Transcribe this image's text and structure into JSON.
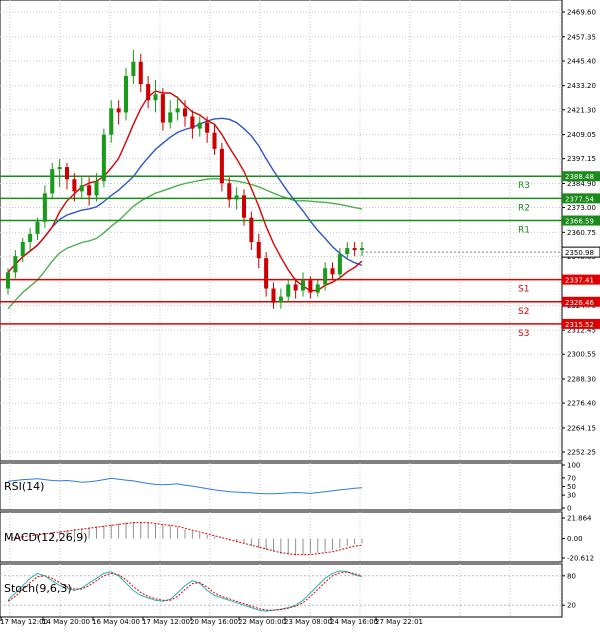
{
  "chart_data": [
    {
      "type": "candlestick",
      "name": "price",
      "ylim": [
        2252.25,
        2469.6
      ],
      "y_ticks": [
        "2469.60",
        "2457.35",
        "2445.40",
        "2433.20",
        "2421.30",
        "2409.05",
        "2397.15",
        "2384.90",
        "2373.00",
        "2360.75",
        "2348.85",
        "2324.70",
        "2312.45",
        "2300.55",
        "2288.30",
        "2276.40",
        "2264.15",
        "2252.25"
      ],
      "x_ticks": [
        "17 May 12:00",
        "14 May 20:00",
        "16 May 04:00",
        "17 May 12:00",
        "20 May 16:00",
        "22 May 00:00",
        "23 May 08:00",
        "24 May 16:00",
        "27 May 22:01"
      ],
      "colors": {
        "up": "#1a9a1a",
        "down": "#cc0000",
        "sma_fast": "#dd0000",
        "sma_mid": "#2e56c8",
        "sma_slow": "#4caf50"
      },
      "levels": [
        {
          "label": "R3",
          "value": 2388.48,
          "text": "2388.48",
          "color": "#1a8a1a"
        },
        {
          "label": "R2",
          "value": 2377.54,
          "text": "2377.54",
          "color": "#1a8a1a"
        },
        {
          "label": "R1",
          "value": 2366.59,
          "text": "2366.59",
          "color": "#1a8a1a"
        },
        {
          "label": "S1",
          "value": 2337.41,
          "text": "2337.41",
          "color": "#dd0000"
        },
        {
          "label": "S2",
          "value": 2326.46,
          "text": "2326.46",
          "color": "#dd0000"
        },
        {
          "label": "S3",
          "value": 2315.52,
          "text": "2315.52",
          "color": "#dd0000"
        }
      ],
      "last_price": {
        "value": 2350.98,
        "text": "2350.98"
      },
      "candles": [
        [
          2333,
          2341,
          2330,
          2343
        ],
        [
          2341,
          2349,
          2338,
          2352
        ],
        [
          2349,
          2356,
          2346,
          2358
        ],
        [
          2356,
          2360,
          2352,
          2363
        ],
        [
          2360,
          2366,
          2357,
          2368
        ],
        [
          2366,
          2380,
          2363,
          2384
        ],
        [
          2380,
          2392,
          2377,
          2395
        ],
        [
          2392,
          2393,
          2383,
          2397
        ],
        [
          2393,
          2387,
          2382,
          2395
        ],
        [
          2387,
          2381,
          2376,
          2390
        ],
        [
          2381,
          2384,
          2378,
          2388
        ],
        [
          2384,
          2379,
          2374,
          2388
        ],
        [
          2379,
          2386,
          2376,
          2390
        ],
        [
          2386,
          2409,
          2383,
          2412
        ],
        [
          2409,
          2422,
          2405,
          2426
        ],
        [
          2422,
          2420,
          2414,
          2426
        ],
        [
          2420,
          2438,
          2416,
          2442
        ],
        [
          2438,
          2445,
          2434,
          2451
        ],
        [
          2445,
          2434,
          2430,
          2449
        ],
        [
          2434,
          2426,
          2422,
          2438
        ],
        [
          2426,
          2429,
          2420,
          2436
        ],
        [
          2429,
          2415,
          2411,
          2432
        ],
        [
          2415,
          2420,
          2412,
          2426
        ],
        [
          2420,
          2422,
          2416,
          2428
        ],
        [
          2422,
          2418,
          2413,
          2426
        ],
        [
          2418,
          2412,
          2407,
          2421
        ],
        [
          2412,
          2415,
          2408,
          2418
        ],
        [
          2415,
          2410,
          2405,
          2418
        ],
        [
          2410,
          2402,
          2399,
          2414
        ],
        [
          2402,
          2385,
          2381,
          2405
        ],
        [
          2385,
          2377,
          2373,
          2388
        ],
        [
          2377,
          2379,
          2372,
          2383
        ],
        [
          2379,
          2368,
          2364,
          2382
        ],
        [
          2368,
          2356,
          2352,
          2371
        ],
        [
          2356,
          2348,
          2343,
          2360
        ],
        [
          2348,
          2333,
          2329,
          2351
        ],
        [
          2333,
          2326,
          2323,
          2336
        ],
        [
          2326,
          2329,
          2323,
          2333
        ],
        [
          2329,
          2335,
          2326,
          2338
        ],
        [
          2335,
          2332,
          2328,
          2338
        ],
        [
          2332,
          2337,
          2329,
          2341
        ],
        [
          2337,
          2331,
          2328,
          2339
        ],
        [
          2331,
          2335,
          2329,
          2338
        ],
        [
          2335,
          2343,
          2332,
          2346
        ],
        [
          2343,
          2340,
          2337,
          2346
        ],
        [
          2340,
          2350,
          2337,
          2353
        ],
        [
          2350,
          2353,
          2348,
          2356
        ],
        [
          2353,
          2352,
          2349,
          2356
        ],
        [
          2352,
          2353,
          2349,
          2356
        ]
      ]
    },
    {
      "type": "line",
      "name": "rsi",
      "label": "RSI(14)",
      "ylim": [
        0,
        100
      ],
      "y_ticks": [
        "100",
        "70",
        "50",
        "30",
        "0"
      ],
      "color": "#2e7de0",
      "values": [
        62,
        64,
        66,
        67,
        68,
        66,
        64,
        63,
        64,
        62,
        60,
        61,
        63,
        66,
        69,
        67,
        65,
        63,
        60,
        57,
        55,
        54,
        55,
        56,
        53,
        51,
        48,
        45,
        42,
        40,
        38,
        37,
        36,
        35,
        34,
        33,
        33,
        34,
        35,
        36,
        35,
        34,
        36,
        38,
        40,
        42,
        44,
        46,
        47
      ]
    },
    {
      "type": "histogram",
      "name": "macd",
      "label": "MACD(12,26,9)",
      "ylim": [
        -20.612,
        21.864
      ],
      "y_ticks": [
        "21.864",
        "0.00",
        "-20.612"
      ],
      "colors": {
        "bars": "#909090",
        "signal": "#dd0000"
      },
      "values": [
        1,
        2,
        3,
        4,
        5,
        6,
        7,
        8,
        9,
        10,
        11,
        12,
        13,
        14,
        15,
        16,
        17,
        18,
        18,
        17,
        16,
        15,
        14,
        12,
        10,
        8,
        6,
        4,
        2,
        0,
        -2,
        -4,
        -6,
        -8,
        -10,
        -12,
        -14,
        -16,
        -17,
        -18,
        -17,
        -16,
        -15,
        -14,
        -12,
        -10,
        -8,
        -6,
        -5
      ],
      "signal": [
        0,
        1,
        2,
        3,
        4,
        5,
        6,
        7,
        8,
        9,
        10,
        11,
        12,
        13,
        14,
        15,
        16,
        17,
        17,
        17,
        16,
        15,
        14,
        13,
        11,
        9,
        7,
        5,
        3,
        1,
        -1,
        -3,
        -5,
        -7,
        -9,
        -11,
        -13,
        -15,
        -16,
        -17,
        -17,
        -17,
        -16,
        -15,
        -14,
        -12,
        -10,
        -8,
        -7
      ]
    },
    {
      "type": "line",
      "name": "stoch",
      "label": "Stoch(9,6,3)",
      "ylim": [
        0,
        100
      ],
      "y_ticks": [
        "80",
        "20"
      ],
      "colors": {
        "k": "#2ab0b0",
        "d": "#dd0000"
      },
      "k": [
        30,
        45,
        60,
        75,
        85,
        80,
        70,
        60,
        55,
        50,
        55,
        65,
        75,
        85,
        88,
        80,
        65,
        50,
        40,
        35,
        30,
        28,
        32,
        45,
        60,
        70,
        65,
        50,
        40,
        35,
        30,
        25,
        20,
        15,
        10,
        8,
        10,
        12,
        15,
        20,
        30,
        45,
        60,
        75,
        85,
        90,
        88,
        82,
        78
      ],
      "d": [
        28,
        38,
        52,
        66,
        78,
        80,
        75,
        66,
        58,
        53,
        53,
        60,
        70,
        80,
        85,
        82,
        72,
        58,
        46,
        38,
        33,
        30,
        30,
        38,
        52,
        64,
        66,
        57,
        45,
        38,
        33,
        28,
        23,
        18,
        13,
        10,
        10,
        11,
        14,
        18,
        25,
        38,
        52,
        67,
        80,
        86,
        88,
        84,
        80
      ]
    }
  ]
}
